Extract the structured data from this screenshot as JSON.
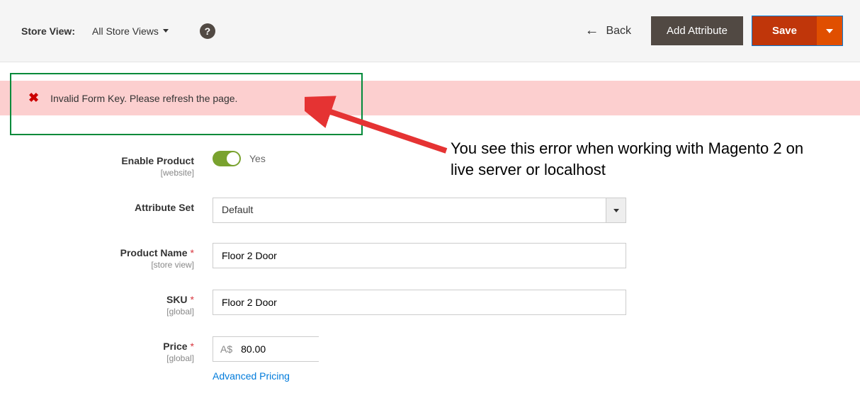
{
  "header": {
    "store_view_label": "Store View:",
    "store_view_value": "All Store Views",
    "back_label": "Back",
    "add_attribute_label": "Add Attribute",
    "save_label": "Save"
  },
  "error": {
    "text": "Invalid Form Key. Please refresh the page."
  },
  "annotation": {
    "text": "You see this error when working with Magento 2 on live server or localhost"
  },
  "form": {
    "enable_product": {
      "label": "Enable Product",
      "scope": "[website]",
      "value_label": "Yes"
    },
    "attribute_set": {
      "label": "Attribute Set",
      "value": "Default"
    },
    "product_name": {
      "label": "Product Name",
      "scope": "[store view]",
      "value": "Floor 2 Door"
    },
    "sku": {
      "label": "SKU",
      "scope": "[global]",
      "value": "Floor 2 Door"
    },
    "price": {
      "label": "Price",
      "scope": "[global]",
      "currency_prefix": "A$",
      "value": "80.00",
      "advanced_label": "Advanced Pricing"
    }
  },
  "colors": {
    "error_bg": "#fccfcf",
    "green_box": "#018a3a",
    "save_orange": "#c0360a",
    "save_caret_bg": "#e04f00",
    "dark_button": "#514943",
    "toggle_green": "#79a22e",
    "link_blue": "#007bdb"
  }
}
